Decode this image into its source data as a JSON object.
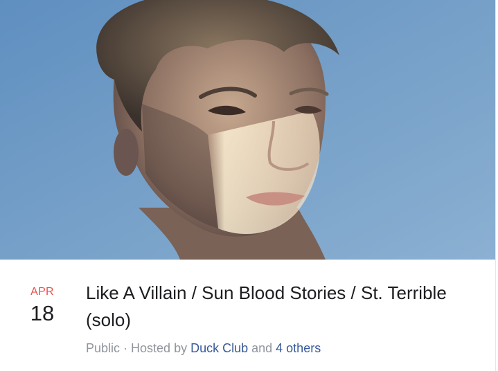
{
  "cover": {
    "image": "portrait-photo",
    "background_color": "#6f9ac3"
  },
  "event": {
    "month": "APR",
    "day": "18",
    "title": "Like A Villain / Sun Blood Stories / St. Terrible (solo)",
    "privacy": "Public",
    "separator": " · ",
    "hosted_by_prefix": "Hosted by ",
    "host_name": "Duck Club",
    "and_text": " and ",
    "others_link": "4 others"
  },
  "colors": {
    "month": "#e8504a",
    "text": "#1c1e21",
    "meta": "#90949c",
    "link": "#365899"
  }
}
